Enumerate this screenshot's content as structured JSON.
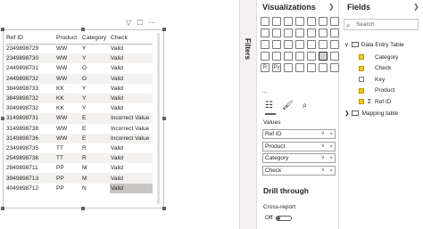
{
  "table": {
    "columns": [
      "Ref ID",
      "Product",
      "Category",
      "Check"
    ],
    "rows": [
      [
        "2349898729",
        "WW",
        "Y",
        "Valid"
      ],
      [
        "2349898730",
        "WW",
        "Y",
        "Valid"
      ],
      [
        "2449898731",
        "WW",
        "O",
        "Valid"
      ],
      [
        "2449898732",
        "WW",
        "O",
        "Valid"
      ],
      [
        "3849898733",
        "KK",
        "Y",
        "Valid"
      ],
      [
        "3849898732",
        "KK",
        "Y",
        "Valid"
      ],
      [
        "3049898732",
        "KK",
        "Y",
        "Valid"
      ],
      [
        "3149898731",
        "WW",
        "E",
        "Incorrect Value"
      ],
      [
        "3149898738",
        "WW",
        "E",
        "Incorrect Value"
      ],
      [
        "3149898736",
        "WW",
        "E",
        "Incorrect Value"
      ],
      [
        "2349898735",
        "TT",
        "R",
        "Valid"
      ],
      [
        "2549898736",
        "TT",
        "R",
        "Valid"
      ],
      [
        "2849898711",
        "PP",
        "M",
        "Valid"
      ],
      [
        "3949898713",
        "PP",
        "M",
        "Valid"
      ],
      [
        "4049898712",
        "PP",
        "N",
        "Valid"
      ]
    ]
  },
  "filters": {
    "label": "Filters"
  },
  "visualizations": {
    "title": "Visualizations",
    "icons": [
      "stacked-bar",
      "stacked-column",
      "clustered-bar",
      "clustered-column",
      "100-bar",
      "100-column",
      "line",
      "area",
      "stacked-area",
      "line-column",
      "line-column-2",
      "ribbon",
      "waterfall",
      "funnel",
      "scatter",
      "pie",
      "donut",
      "treemap",
      "map",
      "filled-map",
      "shape-map",
      "gauge",
      "card",
      "multi-row-card",
      "kpi",
      "slicer",
      "table",
      "matrix",
      "r-visual",
      "python",
      "key-influencers",
      "decomposition",
      "qa",
      "narrative",
      "paginated"
    ],
    "py_label": "Py",
    "r_label": "R",
    "more": "...",
    "values_label": "Values",
    "wells": [
      "Ref ID",
      "Product",
      "Category",
      "Check"
    ],
    "drill_through": "Drill through",
    "cross_report": "Cross-report",
    "toggle_label": "Off"
  },
  "fields": {
    "title": "Fields",
    "search_placeholder": "Search",
    "tables": [
      {
        "name": "Data Entry Table",
        "fields": [
          {
            "name": "Category",
            "checked": true,
            "sigma": false
          },
          {
            "name": "Check",
            "checked": true,
            "sigma": false
          },
          {
            "name": "Key",
            "checked": false,
            "sigma": false
          },
          {
            "name": "Product",
            "checked": true,
            "sigma": false
          },
          {
            "name": "Ref ID",
            "checked": true,
            "sigma": true
          }
        ]
      },
      {
        "name": "Mapping table",
        "fields": []
      }
    ]
  }
}
